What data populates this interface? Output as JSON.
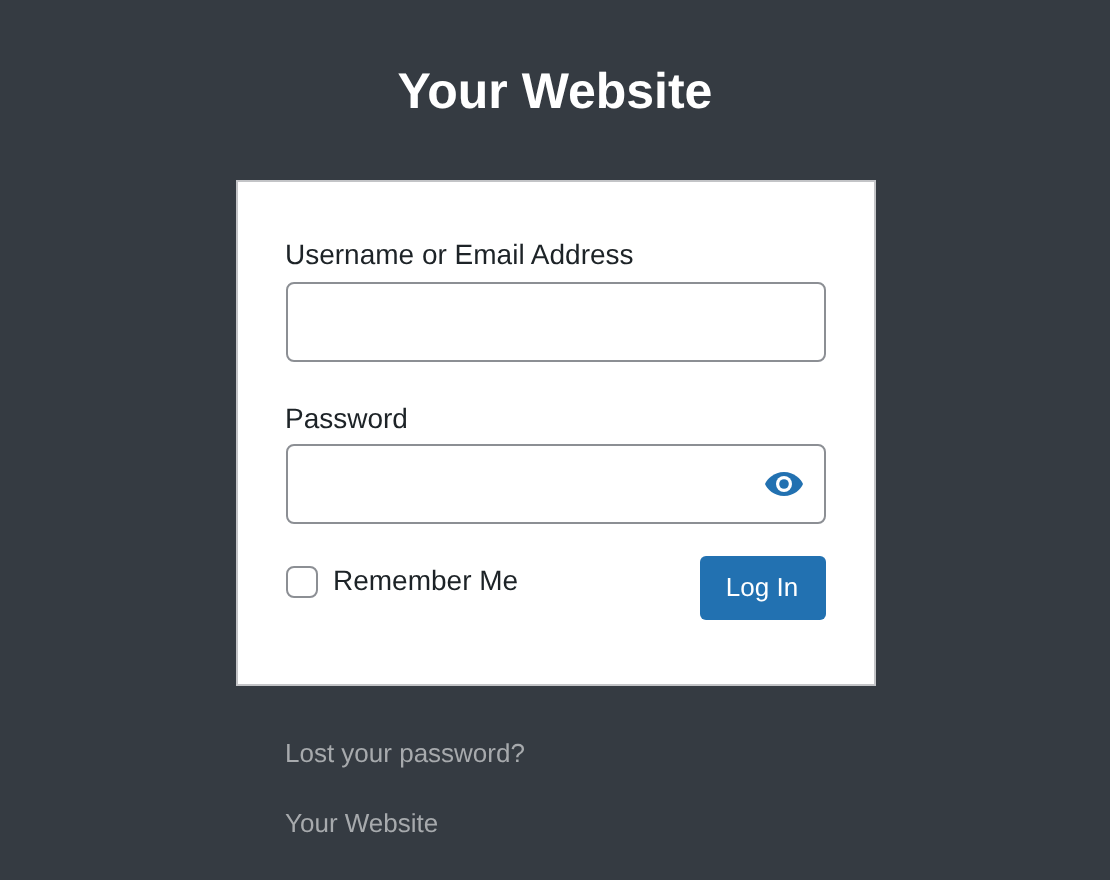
{
  "site_title": "Your Website",
  "form": {
    "username_label": "Username or Email Address",
    "password_label": "Password",
    "remember": {
      "label": "Remember Me",
      "checked": false
    },
    "submit": "Log In"
  },
  "links": [
    "Lost your password?",
    "Your Website"
  ]
}
